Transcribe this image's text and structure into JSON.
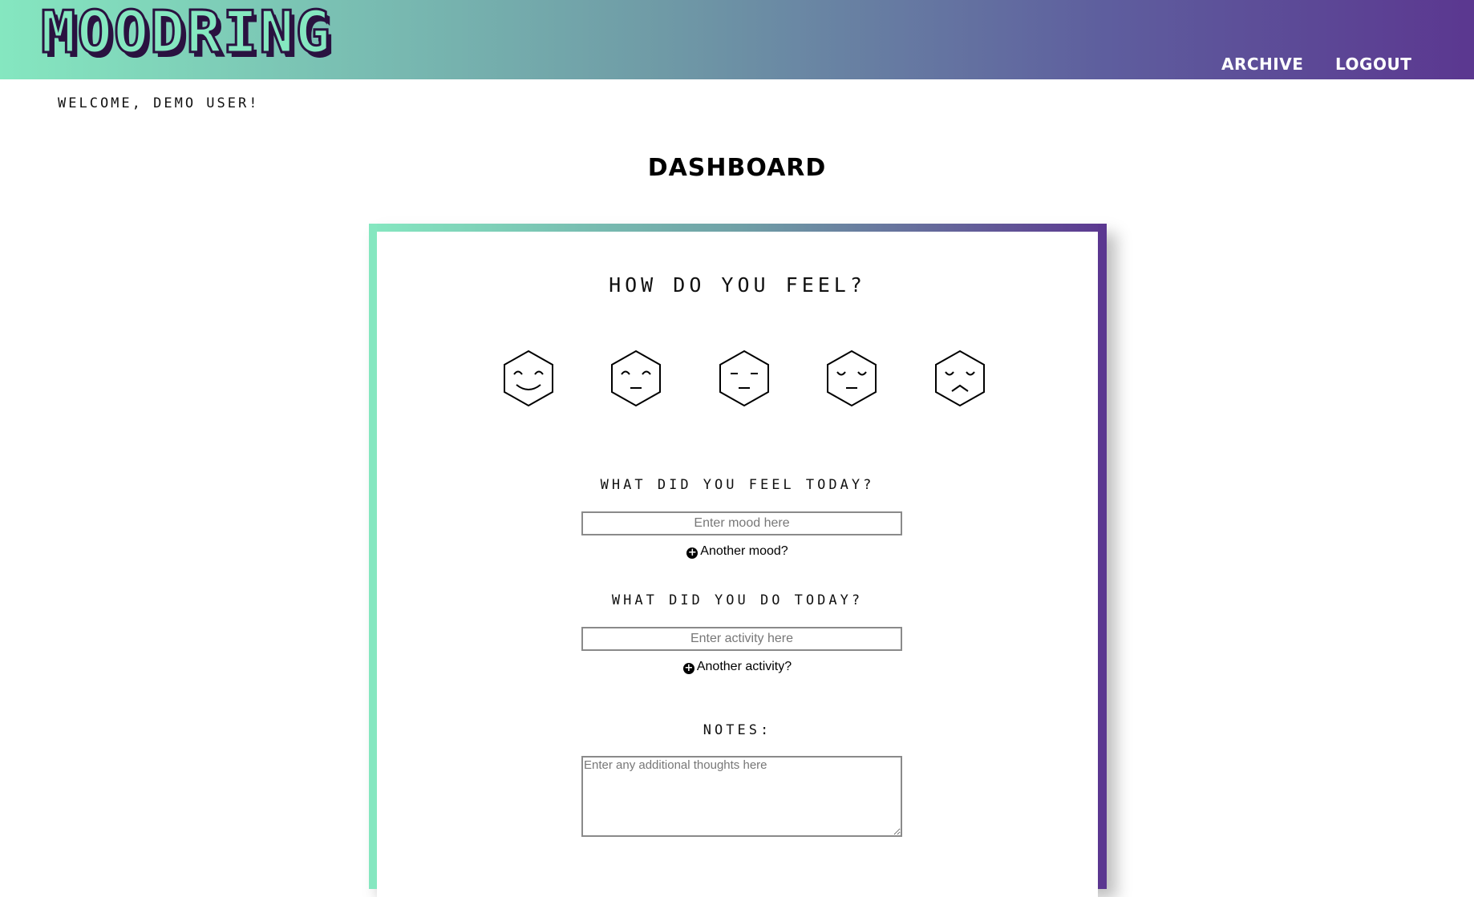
{
  "app": {
    "logo": "MOODRING",
    "nav": {
      "archive": "ARCHIVE",
      "logout": "LOGOUT"
    },
    "colors": {
      "gradient_start": "#85e7c0",
      "gradient_end": "#5b3790"
    }
  },
  "welcome": "WELCOME, DEMO USER!",
  "page_title": "DASHBOARD",
  "form": {
    "feel_title": "HOW DO YOU FEEL?",
    "mood_icons": [
      "very-happy-icon",
      "happy-icon",
      "neutral-icon",
      "sad-icon",
      "very-sad-icon"
    ],
    "moods_title": "WHAT DID YOU FEEL TODAY?",
    "mood_placeholder": "Enter mood here",
    "mood_value": "",
    "add_mood": "Another mood?",
    "activities_title": "WHAT DID YOU DO TODAY?",
    "activity_placeholder": "Enter activity here",
    "activity_value": "",
    "add_activity": "Another activity?",
    "notes_title": "NOTES:",
    "notes_placeholder": "Enter any additional thoughts here",
    "notes_value": ""
  }
}
